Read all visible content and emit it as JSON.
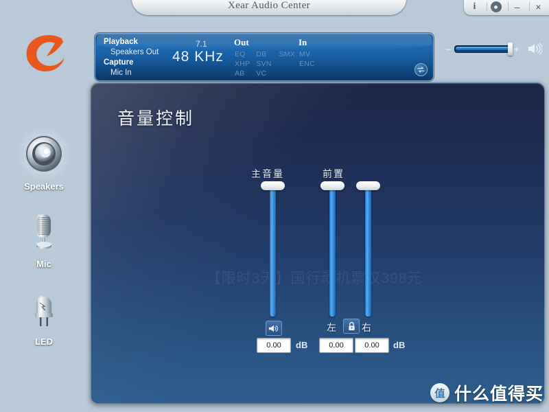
{
  "window": {
    "title": "Xear Audio Center",
    "buttons": [
      {
        "name": "info-button",
        "glyph": "i"
      },
      {
        "name": "settings-button",
        "glyph": "gear"
      },
      {
        "name": "minimize-button",
        "glyph": "–"
      },
      {
        "name": "close-button",
        "glyph": "×"
      }
    ]
  },
  "brand": {
    "name": "cmedia-logo",
    "color": "#e8571e"
  },
  "status": {
    "playback_label": "Playback",
    "playback_value": "Speakers Out",
    "capture_label": "Capture",
    "capture_value": "Mic In",
    "channels": "7.1",
    "samplerate": "48  KHz",
    "out_label": "Out",
    "in_label": "In",
    "out_tags_row1": [
      "EQ",
      "DB",
      "SMX"
    ],
    "out_tags_row2": [
      "XHP",
      "SVN"
    ],
    "out_tags_row3": [
      "AB",
      "VC"
    ],
    "in_tags_row1": [
      "MV"
    ],
    "in_tags_row2": [
      "ENC"
    ],
    "swap_icon": "swap-arrows-icon"
  },
  "master_volume": {
    "minus": "–",
    "plus": "+",
    "level_percent": 100,
    "speaker_icon": "speaker-on-icon"
  },
  "sidebar": {
    "items": [
      {
        "label": "Speakers",
        "icon": "speaker-icon",
        "selected": true
      },
      {
        "label": "Mic",
        "icon": "microphone-icon",
        "selected": false
      },
      {
        "label": "LED",
        "icon": "led-bulb-icon",
        "selected": false
      }
    ]
  },
  "main": {
    "title": "音量控制",
    "ghost_text": "【限时3天】国行动机票仅398元",
    "groups": [
      {
        "label": "主音量",
        "sliders": [
          {
            "value_percent": 100
          }
        ]
      },
      {
        "label": "前置",
        "sliders": [
          {
            "value_percent": 100
          },
          {
            "value_percent": 100
          }
        ]
      }
    ],
    "master_controls": {
      "mute_icon": "speaker-mute-icon",
      "db_value": "0.00",
      "db_unit": "dB"
    },
    "front_controls": {
      "left_label": "左",
      "right_label": "右",
      "lock_icon": "lock-icon",
      "left_db_value": "0.00",
      "right_db_value": "0.00",
      "db_unit": "dB"
    }
  },
  "watermark": {
    "logo_char": "值",
    "text": "什么值得买"
  }
}
